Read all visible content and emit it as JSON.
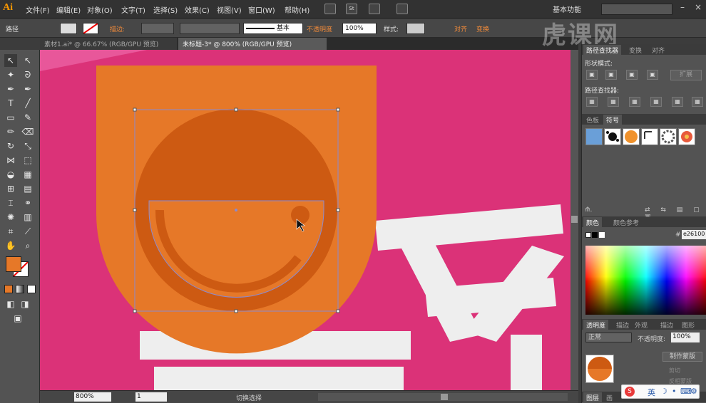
{
  "app": {
    "logo": "Ai"
  },
  "menu": {
    "items": [
      "文件(F)",
      "编辑(E)",
      "对象(O)",
      "文字(T)",
      "选择(S)",
      "效果(C)",
      "视图(V)",
      "窗口(W)",
      "帮助(H)"
    ],
    "workspace": "基本功能",
    "st_icon": "St"
  },
  "control": {
    "selection_type": "路径",
    "stroke_label": "描边:",
    "stroke_profile": "基本",
    "opacity_label": "不透明度",
    "opacity_value": "100%",
    "style_label": "样式:",
    "align_label": "对齐",
    "transform_label": "变换"
  },
  "tabs": [
    {
      "label": "素材1.ai* @ 66.67% (RGB/GPU 预览)",
      "active": false
    },
    {
      "label": "未标题-3* @ 800% (RGB/GPU 预览)",
      "active": true
    }
  ],
  "statusbar": {
    "zoom": "800%",
    "artboard": "1",
    "status_text": "切换选择"
  },
  "panels": {
    "pathfinder_tabs": [
      "路径查找器",
      "变换",
      "对齐"
    ],
    "shape_modes_label": "形状模式:",
    "expand_button": "扩展",
    "pathfinders_label": "路径查找器:",
    "swatches_tabs": [
      "色板",
      "符号"
    ],
    "color_tabs": [
      "颜色",
      "颜色参考"
    ],
    "hex_value": "e26100",
    "transparency_tabs": [
      "透明度",
      "描边",
      "外观",
      "描边",
      "图形"
    ],
    "blend_mode": "正常",
    "opacity_label": "不透明度:",
    "opacity_value": "100%",
    "make_mask_button": "制作蒙版",
    "clip_label": "剪切",
    "invert_label": "反相蒙版",
    "layers_tabs": [
      "图层",
      "画"
    ]
  },
  "colors": {
    "canvas_bg": "#db3278",
    "orange_shape": "#e67828",
    "dark_orange": "#cd5a12",
    "accent_orange": "#f08a3a",
    "selection_outline": "#8a8ad0"
  },
  "ime": {
    "label": "英"
  },
  "watermark": {
    "text": "虎课网"
  }
}
